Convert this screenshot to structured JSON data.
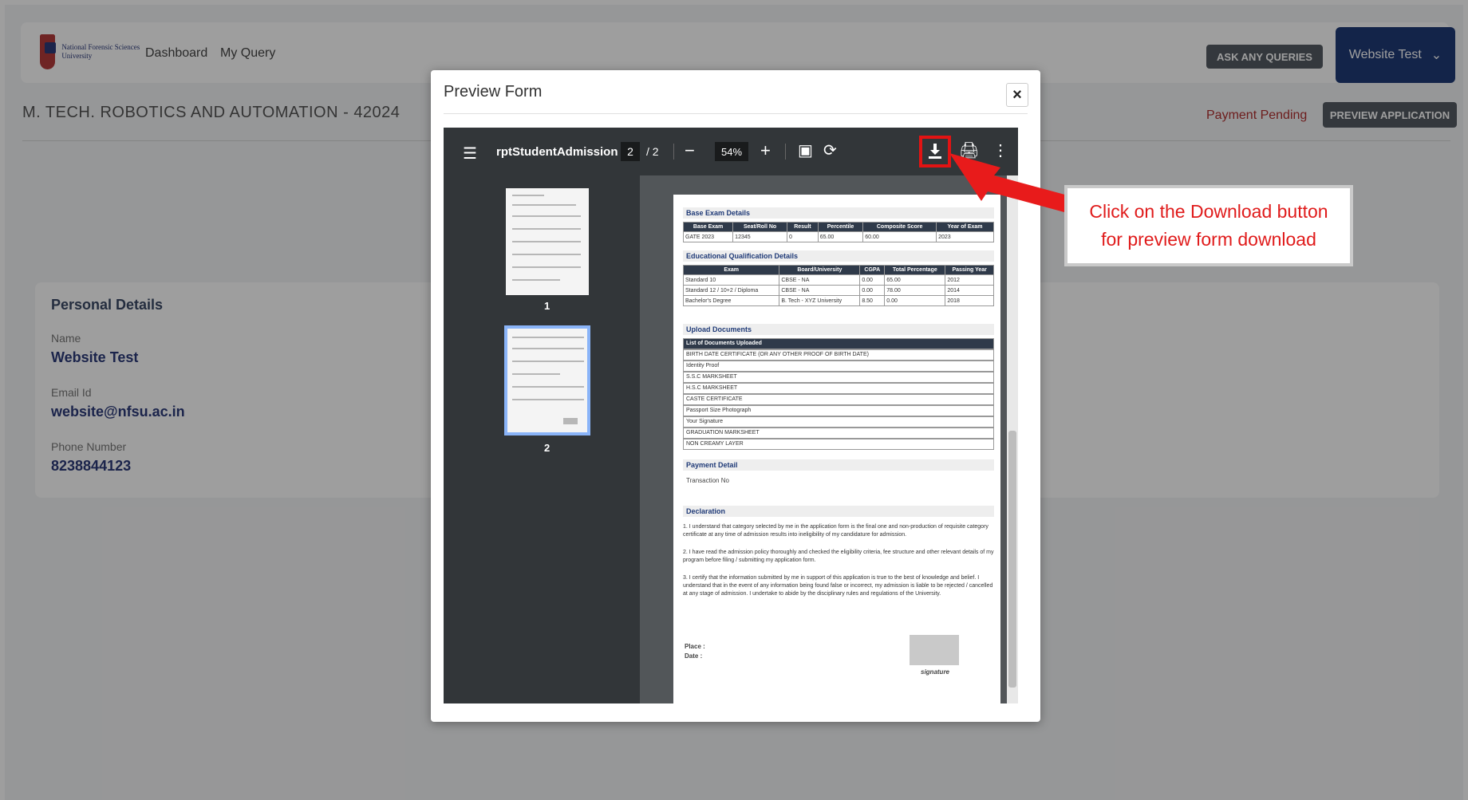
{
  "header": {
    "logo_text": "National Forensic Sciences University",
    "nav": [
      "Dashboard",
      "My Query"
    ],
    "ask_queries_label": "ASK ANY QUERIES",
    "user_name": "Website Test"
  },
  "course": {
    "title": "M. TECH. ROBOTICS AND AUTOMATION - 42024",
    "payment_status": "Payment Pending",
    "preview_button_label": "PREVIEW APPLICATION"
  },
  "personal_details": {
    "title": "Personal Details",
    "name_label": "Name",
    "name_value": "Website Test",
    "email_label": "Email Id",
    "email_value": "website@nfsu.ac.in",
    "phone_label": "Phone Number",
    "phone_value": "8238844123"
  },
  "modal": {
    "title": "Preview Form",
    "close_label": "×"
  },
  "viewer": {
    "file_title": "rptStudentAdmission",
    "current_page": "2",
    "total_pages": "/ 2",
    "zoom": "54%",
    "thumbnails": [
      "1",
      "2"
    ]
  },
  "document": {
    "base_exam_heading": "Base Exam Details",
    "base_exam_headers": [
      "Base Exam",
      "Seat/Roll No",
      "Result",
      "Percentile",
      "Composite Score",
      "Year of Exam"
    ],
    "base_exam_row": [
      "GATE 2023",
      "12345",
      "0",
      "65.00",
      "60.00",
      "2023"
    ],
    "edu_heading": "Educational Qualification Details",
    "edu_headers": [
      "Exam",
      "Board/University",
      "CGPA",
      "Total Percentage",
      "Passing Year"
    ],
    "edu_rows": [
      [
        "Standard 10",
        "CBSE - NA",
        "0.00",
        "65.00",
        "2012"
      ],
      [
        "Standard 12 / 10+2 / Diploma",
        "CBSE - NA",
        "0.00",
        "78.00",
        "2014"
      ],
      [
        "Bachelor's Degree",
        "B. Tech - XYZ University",
        "8.50",
        "0.00",
        "2018"
      ]
    ],
    "upload_heading": "Upload Documents",
    "documents_list_header": "List of Documents Uploaded",
    "documents": [
      "BIRTH DATE CERTIFICATE (OR ANY OTHER PROOF OF BIRTH DATE)",
      "Identity Proof",
      "S.S.C MARKSHEET",
      "H.S.C MARKSHEET",
      "CASTE CERTIFICATE",
      "Passport Size Photograph",
      "Your Signature",
      "GRADUATION MARKSHEET",
      "NON CREAMY LAYER"
    ],
    "payment_heading": "Payment Detail",
    "transaction_label": "Transaction No",
    "declaration_heading": "Declaration",
    "declarations": [
      "1.   I understand that category selected by me in the application form is the final one and non-production of requisite category certificate at any time of admission results into ineligibility of my candidature for admission.",
      "2.   I have read the admission policy thoroughly and checked the eligibility criteria, fee structure and other relevant details of my program before filing / submitting my application form.",
      "3.   I certify that the information submitted by me in support of this application is true to the best of knowledge and belief. I understand that in the event of any information being found false or incorrect, my admission is liable to be rejected / cancelled at any stage of admission. I undertake to abide by the disciplinary rules and regulations of the University."
    ],
    "place_label": "Place :",
    "date_label": "Date :",
    "signature_label": "signature"
  },
  "callout": {
    "line1": "Click on the Download button",
    "line2": "for preview form download"
  },
  "colors": {
    "brand_navy": "#1f3a77",
    "toolbar_dark": "#323639",
    "highlight_red": "#e21313"
  }
}
